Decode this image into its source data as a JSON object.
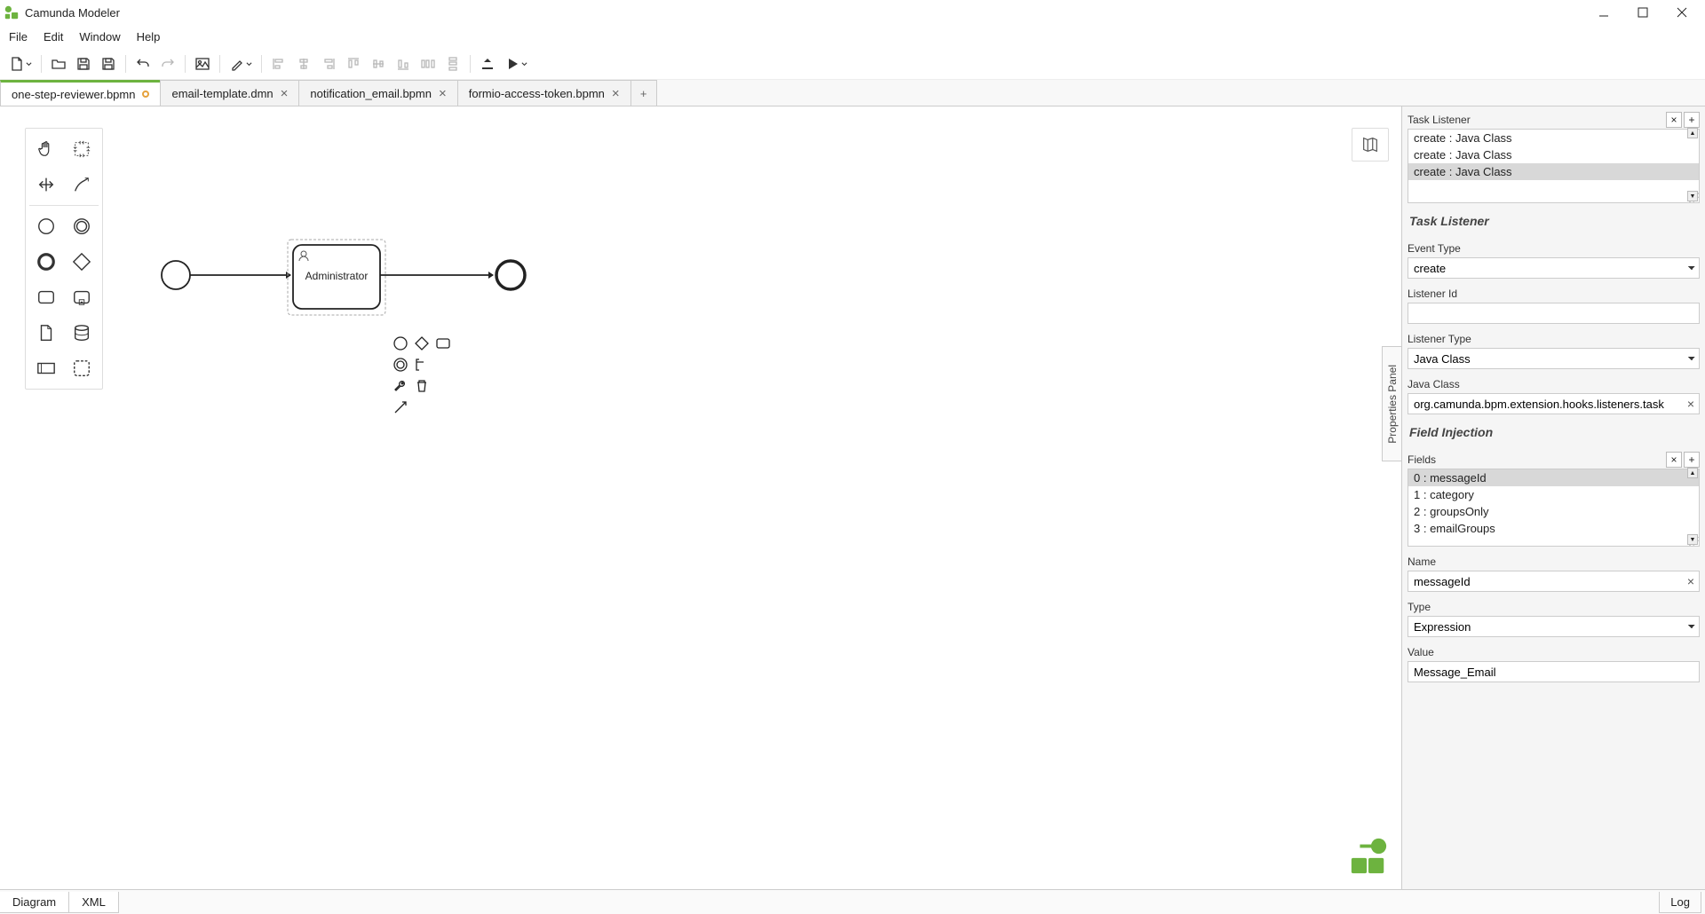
{
  "app": {
    "title": "Camunda Modeler"
  },
  "menu": {
    "file": "File",
    "edit": "Edit",
    "window": "Window",
    "help": "Help"
  },
  "tabs": [
    {
      "label": "one-step-reviewer.bpmn",
      "active": true,
      "dirty": true
    },
    {
      "label": "email-template.dmn",
      "active": false,
      "closable": true
    },
    {
      "label": "notification_email.bpmn",
      "active": false,
      "closable": true
    },
    {
      "label": "formio-access-token.bpmn",
      "active": false,
      "closable": true
    }
  ],
  "diagram": {
    "task_label": "Administrator"
  },
  "props_toggle_label": "Properties Panel",
  "props": {
    "task_listener_section": "Task Listener",
    "listeners": [
      {
        "label": "create : Java Class",
        "selected": false
      },
      {
        "label": "create : Java Class",
        "selected": false
      },
      {
        "label": "create : Java Class",
        "selected": true
      }
    ],
    "event_type_label": "Event Type",
    "event_type_value": "create",
    "listener_id_label": "Listener Id",
    "listener_id_value": "",
    "listener_type_label": "Listener Type",
    "listener_type_value": "Java Class",
    "java_class_label": "Java Class",
    "java_class_value": "org.camunda.bpm.extension.hooks.listeners.task",
    "field_injection_section": "Field Injection",
    "fields_label": "Fields",
    "fields": [
      {
        "label": "0 : messageId",
        "selected": true
      },
      {
        "label": "1 : category",
        "selected": false
      },
      {
        "label": "2 : groupsOnly",
        "selected": false
      },
      {
        "label": "3 : emailGroups",
        "selected": false
      }
    ],
    "name_label": "Name",
    "name_value": "messageId",
    "type_label": "Type",
    "type_value": "Expression",
    "value_label": "Value",
    "value_value": "Message_Email"
  },
  "bottom": {
    "diagram": "Diagram",
    "xml": "XML",
    "log": "Log"
  }
}
